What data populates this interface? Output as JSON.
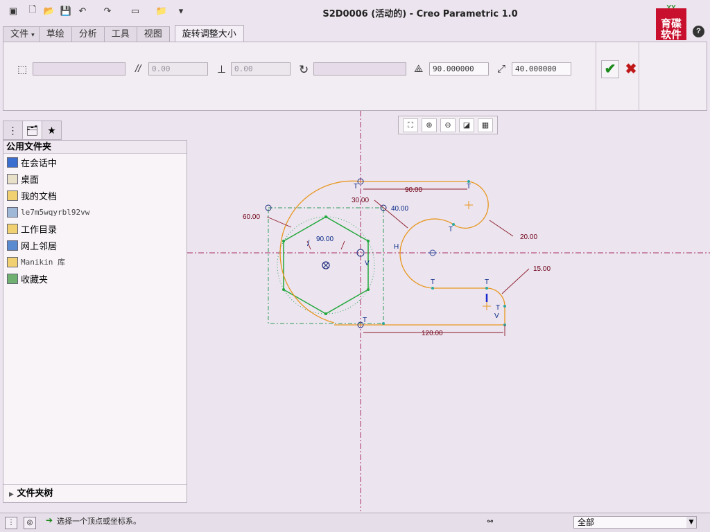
{
  "window": {
    "title": "S2D0006 (活动的) - Creo Parametric 1.0"
  },
  "quick_access": {
    "icons": [
      "app-icon",
      "new-icon",
      "open-icon",
      "save-icon",
      "undo-icon",
      "redo-icon",
      "window-icon",
      "close-window-icon",
      "customize-icon"
    ]
  },
  "logo": {
    "top": "YY",
    "text": "育碟软件"
  },
  "tabs": [
    {
      "label": "文件",
      "suffix": "▾"
    },
    {
      "label": "草绘"
    },
    {
      "label": "分析"
    },
    {
      "label": "工具"
    },
    {
      "label": "视图"
    },
    {
      "label": "旋转调整大小"
    }
  ],
  "ribbon": {
    "fields": [
      {
        "value": "",
        "placeholder": ""
      },
      {
        "value": "0.00"
      },
      {
        "value": "0.00"
      },
      {
        "value": ""
      },
      {
        "value": "90.000000"
      },
      {
        "value": "40.000000"
      }
    ],
    "ok_label": "✔",
    "cancel_label": "✖"
  },
  "navigator": {
    "header": "公用文件夹",
    "items": [
      {
        "label": "在会话中",
        "icon": "session-icon"
      },
      {
        "label": "桌面",
        "icon": "desktop-icon"
      },
      {
        "label": "我的文档",
        "icon": "documents-icon"
      },
      {
        "label": "le7m5wqyrbl92vw",
        "icon": "computer-icon"
      },
      {
        "label": "工作目录",
        "icon": "working-dir-icon"
      },
      {
        "label": "网上邻居",
        "icon": "network-icon"
      },
      {
        "label": "Manikin 库",
        "icon": "manikin-icon"
      },
      {
        "label": "收藏夹",
        "icon": "favorites-icon"
      }
    ],
    "footer": "文件夹树"
  },
  "sketch": {
    "dims": {
      "top_length": "90.00",
      "r30": "30.00",
      "r40": "40.00",
      "d60": "60.00",
      "angle": "90.00",
      "r20": "20.00",
      "r15": "15.00",
      "bottom_length": "120.00"
    },
    "labels": {
      "t": "T",
      "h": "H",
      "v": "V"
    }
  },
  "status": {
    "message": "选择一个顶点或坐标系。",
    "filter": "全部"
  },
  "colors": {
    "sketch_orange": "#e8961e",
    "hexagon_green": "#22a83c",
    "centerline": "#a6306a",
    "dimension": "#6e0018"
  }
}
